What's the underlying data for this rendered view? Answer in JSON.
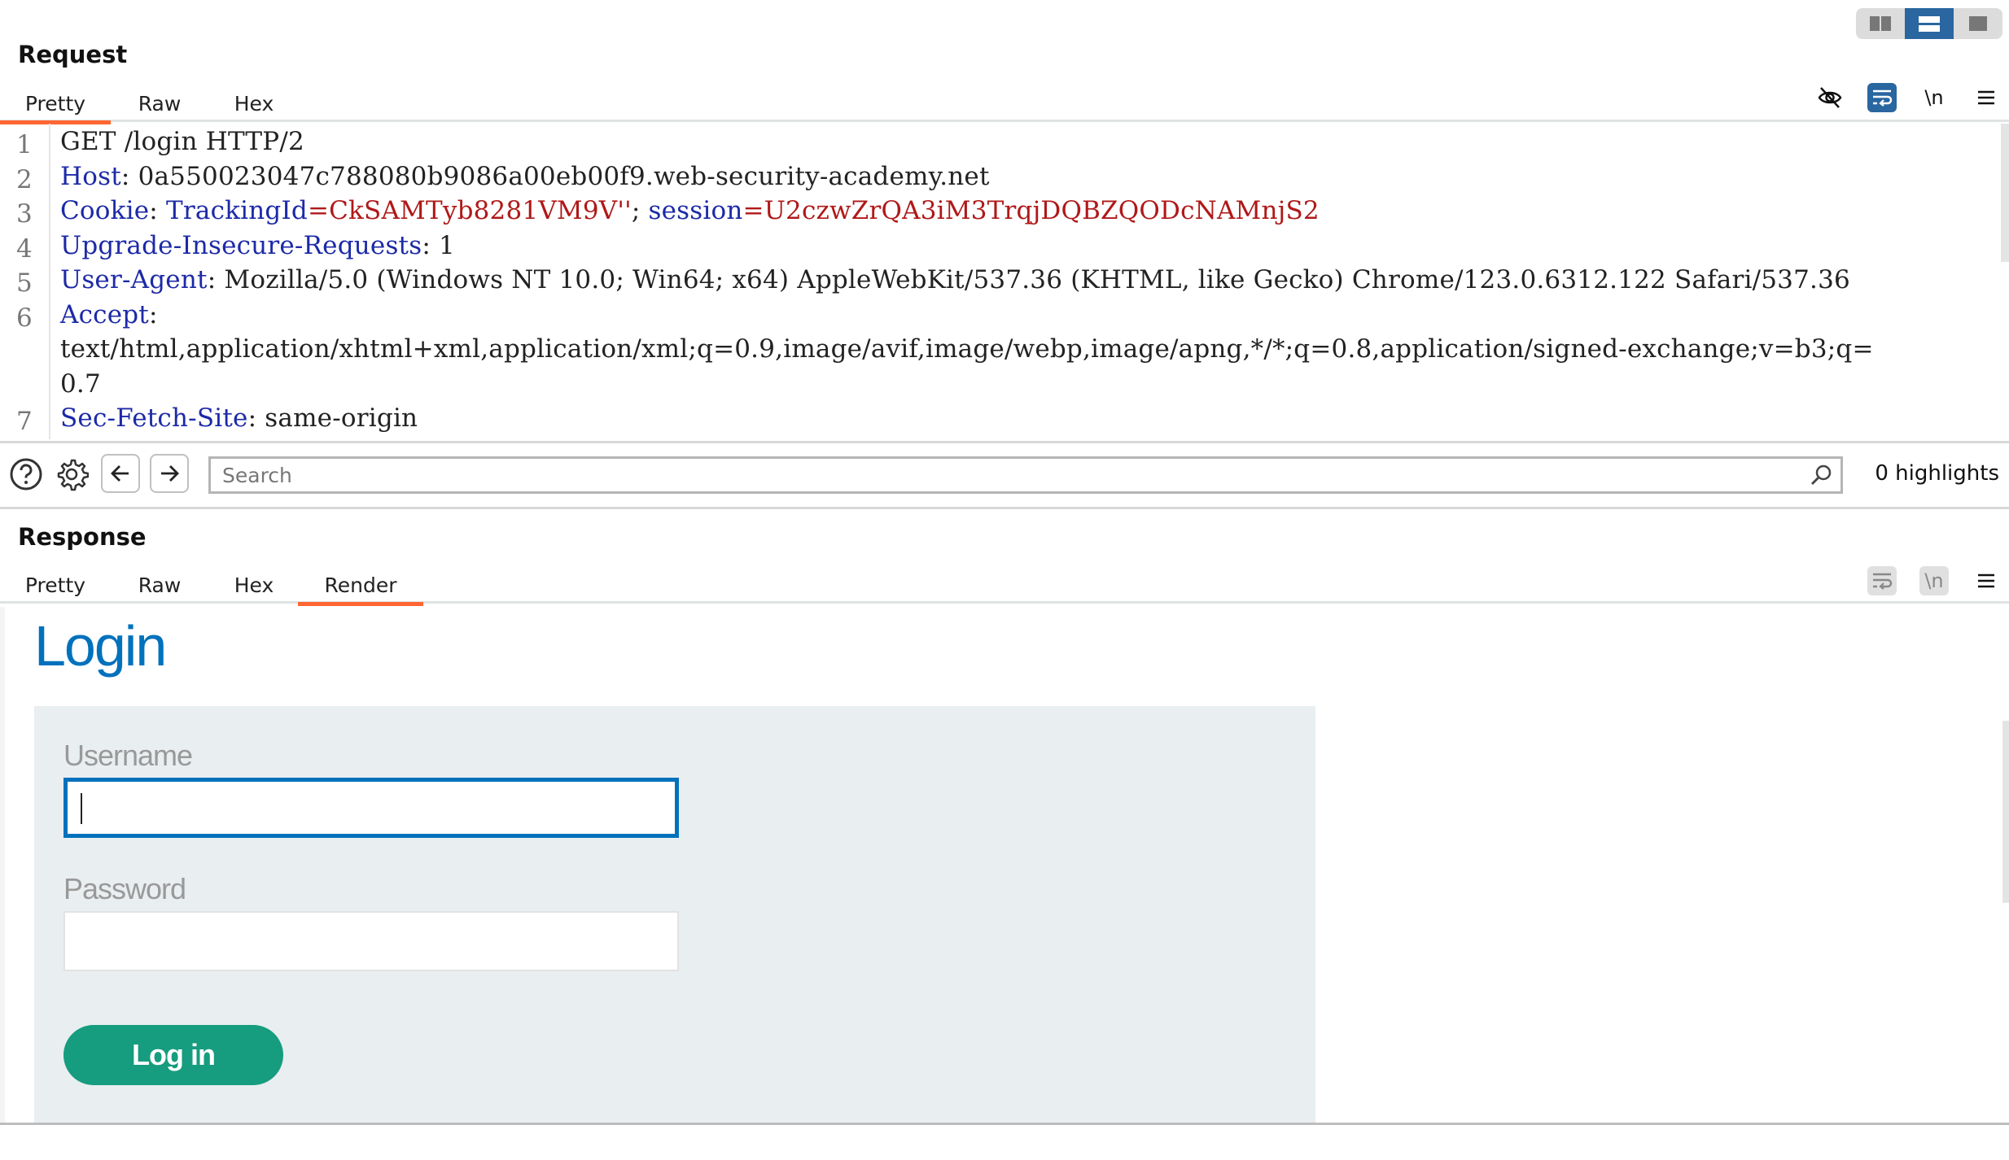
{
  "layout_toggle": {
    "options": [
      "side-by-side",
      "stacked",
      "single"
    ],
    "active": "stacked"
  },
  "request": {
    "title": "Request",
    "tabs": [
      {
        "label": "Pretty",
        "active": true
      },
      {
        "label": "Raw",
        "active": false
      },
      {
        "label": "Hex",
        "active": false
      }
    ],
    "tools": {
      "hide_icon": "eye-slash-icon",
      "wrap_icon": "text-wrap-icon",
      "newline_label": "\\n",
      "menu_icon": "hamburger-menu-icon"
    },
    "lines": [
      {
        "num": "1",
        "parts": [
          {
            "t": "GET /login HTTP/2",
            "c": "plain"
          }
        ]
      },
      {
        "num": "2",
        "parts": [
          {
            "t": "Host",
            "c": "hname"
          },
          {
            "t": ": 0a550023047c788080b9086a00eb00f9.web-security-academy.net",
            "c": "plain"
          }
        ]
      },
      {
        "num": "3",
        "parts": [
          {
            "t": "Cookie",
            "c": "hname"
          },
          {
            "t": ": ",
            "c": "plain"
          },
          {
            "t": "TrackingId",
            "c": "hname"
          },
          {
            "t": "=CkSAMTyb8281VM9V''",
            "c": "cval"
          },
          {
            "t": "; ",
            "c": "plain"
          },
          {
            "t": "session",
            "c": "hname"
          },
          {
            "t": "=U2czwZrQA3iM3TrqjDQBZQODcNAMnjS2",
            "c": "cval"
          }
        ]
      },
      {
        "num": "4",
        "parts": [
          {
            "t": "Upgrade-Insecure-Requests",
            "c": "hname"
          },
          {
            "t": ": 1",
            "c": "plain"
          }
        ]
      },
      {
        "num": "5",
        "parts": [
          {
            "t": "User-Agent",
            "c": "hname"
          },
          {
            "t": ": Mozilla/5.0 (Windows NT 10.0; Win64; x64) AppleWebKit/537.36 (KHTML, like Gecko) Chrome/123.0.6312.122 Safari/537.36",
            "c": "plain"
          }
        ]
      },
      {
        "num": "6",
        "parts": [
          {
            "t": "Accept",
            "c": "hname"
          },
          {
            "t": ":",
            "c": "plain"
          }
        ]
      },
      {
        "num": "",
        "parts": [
          {
            "t": "text/html,application/xhtml+xml,application/xml;q=0.9,image/avif,image/webp,image/apng,*/*;q=0.8,application/signed-exchange;v=b3;q=",
            "c": "plain"
          }
        ]
      },
      {
        "num": "",
        "parts": [
          {
            "t": "0.7",
            "c": "plain"
          }
        ]
      },
      {
        "num": "7",
        "parts": [
          {
            "t": "Sec-Fetch-Site",
            "c": "hname"
          },
          {
            "t": ": same-origin",
            "c": "plain"
          }
        ]
      }
    ]
  },
  "search": {
    "placeholder": "Search",
    "value": "",
    "highlights": "0 highlights"
  },
  "response": {
    "title": "Response",
    "tabs": [
      {
        "label": "Pretty",
        "active": false
      },
      {
        "label": "Raw",
        "active": false
      },
      {
        "label": "Hex",
        "active": false
      },
      {
        "label": "Render",
        "active": true
      }
    ],
    "tools": {
      "newline_label": "\\n"
    },
    "render": {
      "heading": "Login",
      "username_label": "Username",
      "username_value": "",
      "password_label": "Password",
      "password_value": "",
      "button_label": "Log in"
    }
  },
  "colors": {
    "accent_orange": "#ff6633",
    "burp_blue": "#2a66a0",
    "header_name": "#1c2aa7",
    "cookie_value": "#b01818",
    "login_blue": "#0071bc",
    "login_green": "#169c7f"
  }
}
